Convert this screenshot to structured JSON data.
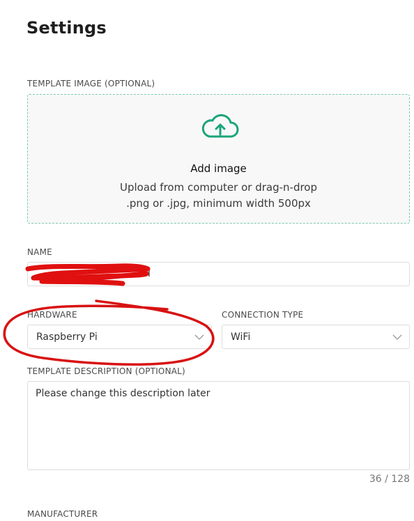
{
  "page": {
    "title": "Settings"
  },
  "template_image": {
    "label": "TEMPLATE IMAGE (OPTIONAL)",
    "title": "Add image",
    "line1": "Upload from computer or drag-n-drop",
    "line2": ".png or .jpg, minimum width 500px",
    "icon": "cloud-upload-icon",
    "accent": "#1aa57a"
  },
  "name": {
    "label": "NAME",
    "value": "l"
  },
  "hardware": {
    "label": "HARDWARE",
    "value": "Raspberry Pi"
  },
  "connection": {
    "label": "CONNECTION TYPE",
    "value": "WiFi"
  },
  "description": {
    "label": "TEMPLATE DESCRIPTION (OPTIONAL)",
    "value": "Please change this description later",
    "counter": "36 / 128"
  },
  "manufacturer": {
    "label": "MANUFACTURER"
  }
}
